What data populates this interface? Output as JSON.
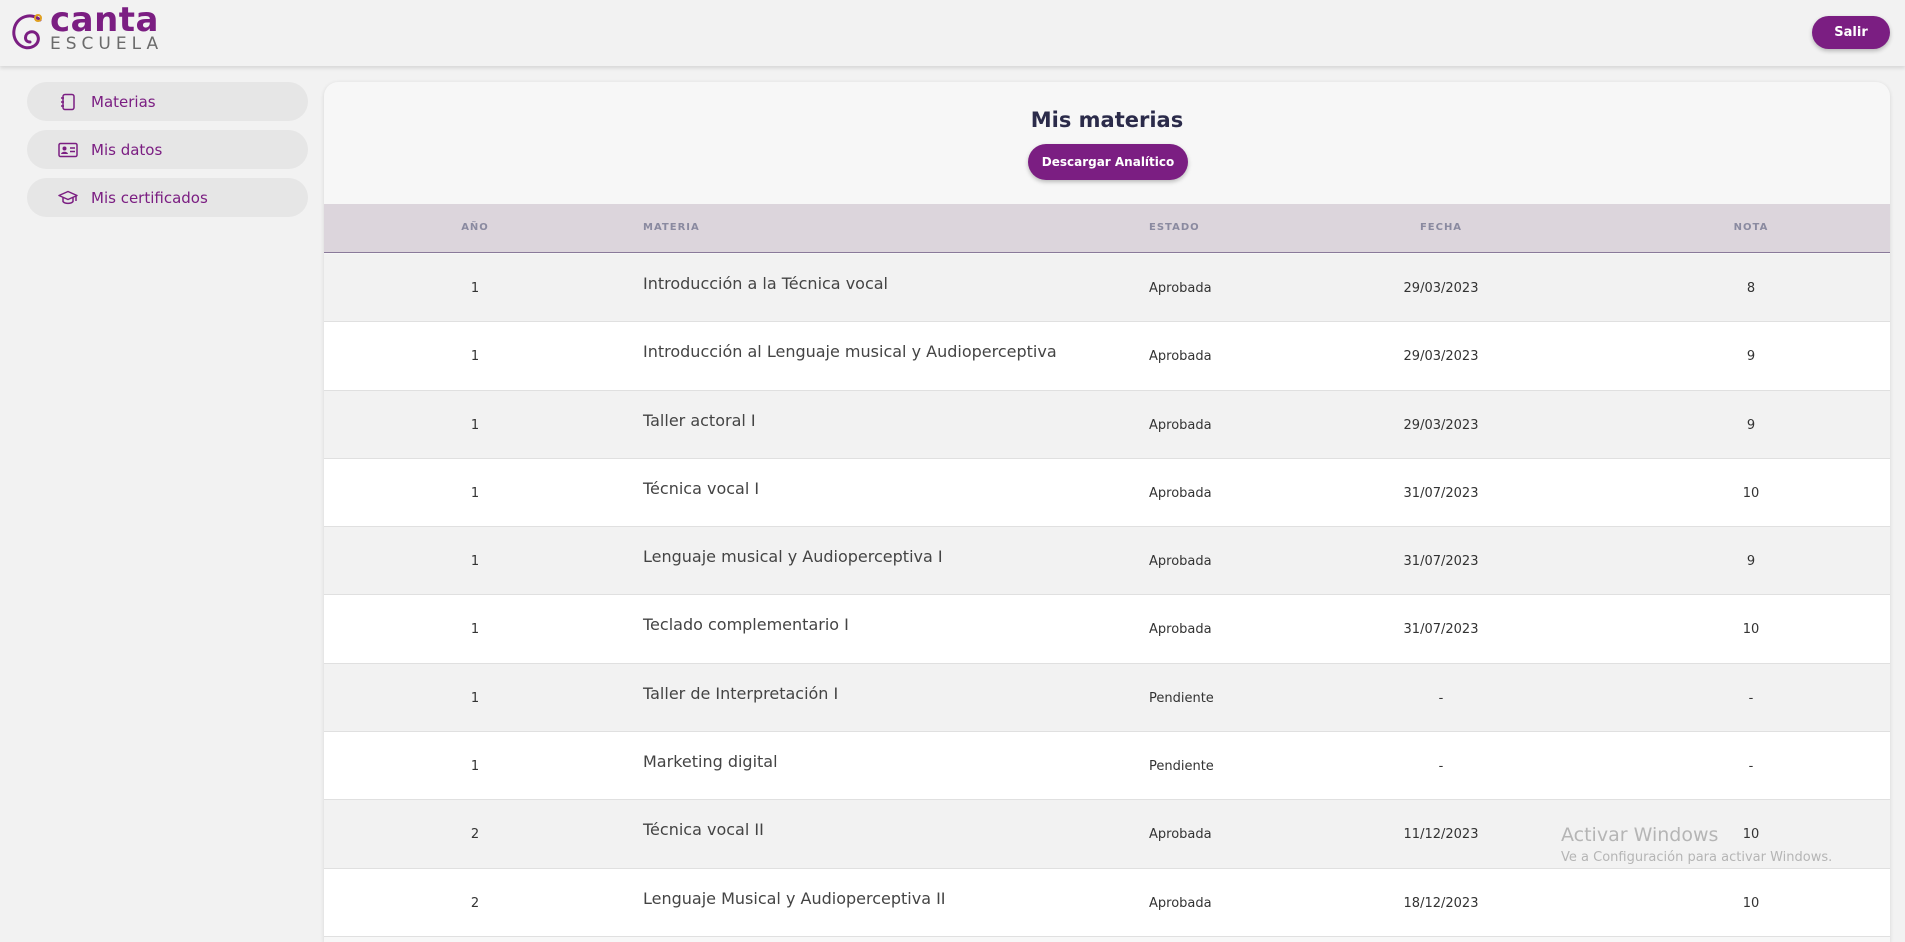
{
  "header": {
    "logo_top": "canta",
    "logo_bottom": "ESCUELA",
    "logout_label": "Salir"
  },
  "colors": {
    "brand": "#7b1e82",
    "header_bg": "#f2f2f2",
    "table_header_bg": "#dcd5dc"
  },
  "sidebar": {
    "items": [
      {
        "label": "Materias",
        "icon": "notebook-icon"
      },
      {
        "label": "Mis datos",
        "icon": "id-card-icon"
      },
      {
        "label": "Mis certificados",
        "icon": "graduation-cap-icon"
      }
    ]
  },
  "main": {
    "title": "Mis materias",
    "download_label": "Descargar Analítico",
    "columns": [
      "AÑO",
      "MATERIA",
      "ESTADO",
      "FECHA",
      "NOTA"
    ],
    "rows": [
      [
        "1",
        "Introducción a la Técnica vocal",
        "Aprobada",
        "29/03/2023",
        "8"
      ],
      [
        "1",
        "Introducción al Lenguaje musical y Audioperceptiva",
        "Aprobada",
        "29/03/2023",
        "9"
      ],
      [
        "1",
        "Taller actoral I",
        "Aprobada",
        "29/03/2023",
        "9"
      ],
      [
        "1",
        "Técnica vocal I",
        "Aprobada",
        "31/07/2023",
        "10"
      ],
      [
        "1",
        "Lenguaje musical y Audioperceptiva I",
        "Aprobada",
        "31/07/2023",
        "9"
      ],
      [
        "1",
        "Teclado complementario I",
        "Aprobada",
        "31/07/2023",
        "10"
      ],
      [
        "1",
        "Taller de Interpretación I",
        "Pendiente",
        "-",
        "-"
      ],
      [
        "1",
        "Marketing digital",
        "Pendiente",
        "-",
        "-"
      ],
      [
        "2",
        "Técnica vocal II",
        "Aprobada",
        "11/12/2023",
        "10"
      ],
      [
        "2",
        "Lenguaje Musical y Audioperceptiva II",
        "Aprobada",
        "18/12/2023",
        "10"
      ]
    ]
  },
  "watermark": {
    "title": "Activar Windows",
    "subtitle": "Ve a Configuración para activar Windows."
  }
}
